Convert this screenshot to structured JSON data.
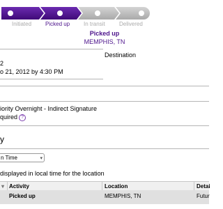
{
  "progress": {
    "steps": [
      "Initiated",
      "Picked up",
      "In transit",
      "Delivered"
    ],
    "current_index": 1,
    "active_color": "#4d148c",
    "inactive_color": "#bdbdbd"
  },
  "status": {
    "title": "Picked up",
    "location": "MEMPHIS, TN"
  },
  "details": {
    "left_value_1": "2",
    "destination_label": "Destination",
    "ship_date": "o 21, 2012 by 4:30 PM",
    "service_line1": "iority Overnight - Indirect Signature",
    "service_line2": "quired",
    "help_icon": "?"
  },
  "section": {
    "heading": "y"
  },
  "filter": {
    "selected": "n Time"
  },
  "note": "displayed in local time for the location",
  "table": {
    "columns": [
      "Activity",
      "Location",
      "Detai"
    ],
    "rows": [
      {
        "activity": "Picked up",
        "location": "MEMPHIS, TN",
        "details": "Futur"
      }
    ]
  }
}
